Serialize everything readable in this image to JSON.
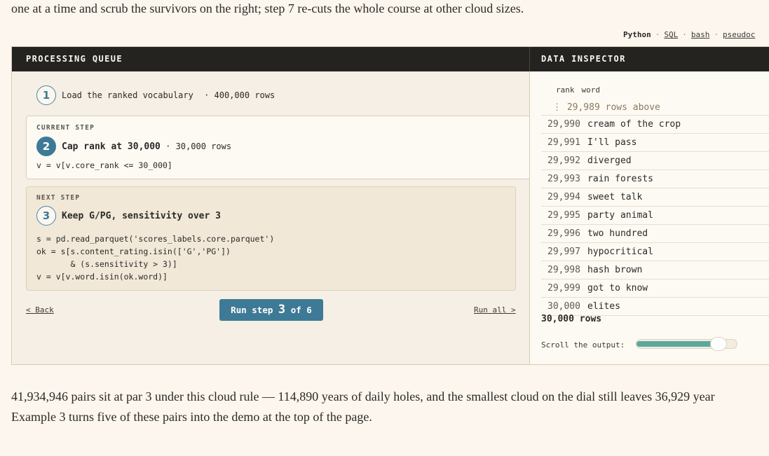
{
  "intro": "one at a time and scrub the survivors on the right; step 7 re-cuts the whole course at other cloud sizes.",
  "languages": [
    "Python",
    "SQL",
    "bash",
    "pseudoc"
  ],
  "queue": {
    "header": "PROCESSING QUEUE",
    "step1": {
      "num": "1",
      "label": "Load the ranked vocabulary",
      "meta": "· 400,000 rows"
    },
    "current": {
      "kicker": "CURRENT STEP",
      "num": "2",
      "title": "Cap rank at 30,000",
      "meta": "· 30,000 rows",
      "code": "v = v[v.core_rank <= 30_000]"
    },
    "next": {
      "kicker": "NEXT STEP",
      "num": "3",
      "title": "Keep G/PG, sensitivity over 3",
      "code": "s = pd.read_parquet('scores_labels.core.parquet')\nok = s[s.content_rating.isin(['G','PG'])\n       & (s.sensitivity > 3)]\nv = v[v.word.isin(ok.word)]"
    },
    "back_label": "< Back",
    "run_all_label": "Run all >",
    "run": {
      "prefix": "Run step",
      "step": "3",
      "of": "of 6"
    }
  },
  "inspector": {
    "header": "DATA INSPECTOR",
    "columns": [
      "rank",
      "word"
    ],
    "above": "⋮ 29,989 rows above",
    "rows": [
      {
        "rank": "29,990",
        "word": "cream of the crop"
      },
      {
        "rank": "29,991",
        "word": "I'll pass"
      },
      {
        "rank": "29,992",
        "word": "diverged"
      },
      {
        "rank": "29,993",
        "word": "rain forests"
      },
      {
        "rank": "29,994",
        "word": "sweet talk"
      },
      {
        "rank": "29,995",
        "word": "party animal"
      },
      {
        "rank": "29,996",
        "word": "two hundred"
      },
      {
        "rank": "29,997",
        "word": "hypocritical"
      },
      {
        "rank": "29,998",
        "word": "hash brown"
      },
      {
        "rank": "29,999",
        "word": "got to know"
      },
      {
        "rank": "30,000",
        "word": "elites"
      }
    ],
    "total": "30,000 rows",
    "scroll_label": "Scroll the output:",
    "scroll_value": 0.88
  },
  "outro_line1": "41,934,946 pairs sit at par 3 under this cloud rule — 114,890 years of daily holes, and the smallest cloud on the dial still leaves 36,929 year",
  "outro_line2": "Example 3 turns five of these pairs into the demo at the top of the page.",
  "colors": {
    "accent": "#3e7a96",
    "slider": "#5ba89c",
    "header_bg": "#242320",
    "page_bg": "#fdf6ee"
  }
}
